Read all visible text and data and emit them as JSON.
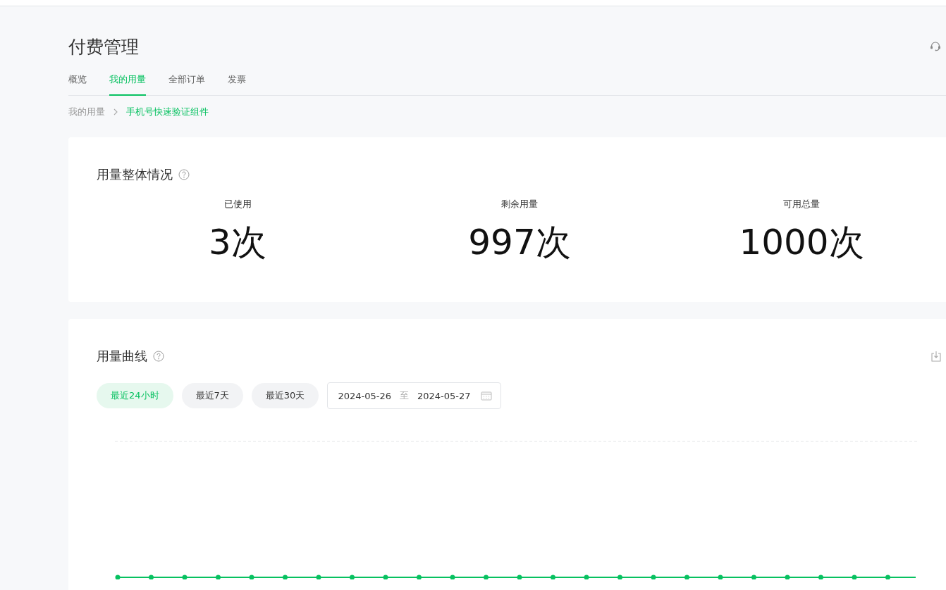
{
  "page": {
    "title": "付费管理"
  },
  "tabs": [
    {
      "label": "概览",
      "selected": false
    },
    {
      "label": "我的用量",
      "selected": true
    },
    {
      "label": "全部订单",
      "selected": false
    },
    {
      "label": "发票",
      "selected": false
    }
  ],
  "breadcrumb": [
    {
      "label": "我的用量",
      "current": false
    },
    {
      "label": "手机号快速验证组件",
      "current": true
    }
  ],
  "overview": {
    "title": "用量整体情况",
    "stats": [
      {
        "label": "已使用",
        "value": "3次"
      },
      {
        "label": "剩余用量",
        "value": "997次"
      },
      {
        "label": "可用总量",
        "value": "1000次"
      }
    ]
  },
  "usage_curve": {
    "title": "用量曲线",
    "ranges": [
      {
        "label": "最近24小时",
        "selected": true
      },
      {
        "label": "最近7天",
        "selected": false
      },
      {
        "label": "最近30天",
        "selected": false
      }
    ],
    "date_range": {
      "start": "2024-05-26",
      "separator": "至",
      "end": "2024-05-27"
    }
  }
}
